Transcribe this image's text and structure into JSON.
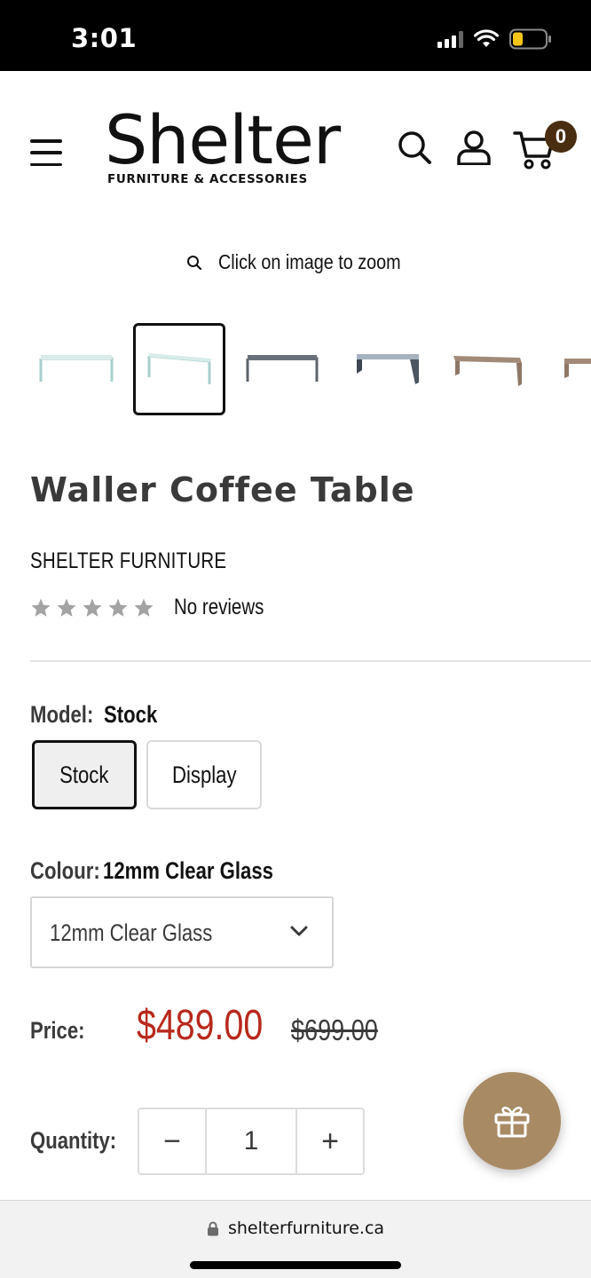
{
  "status_bar": {
    "time": "3:01",
    "icons": [
      "signal-icon",
      "wifi-icon",
      "battery-icon"
    ]
  },
  "header": {
    "menu_icon": "hamburger-menu-icon",
    "logo_title": "Shelter",
    "logo_subtitle": "FURNITURE & ACCESSORIES",
    "search_icon": "search-icon",
    "account_icon": "user-icon",
    "cart_icon": "cart-icon",
    "cart_count": "0"
  },
  "gallery": {
    "zoom_hint": "Click on image to zoom",
    "selected_index": 1,
    "thumbnails": [
      {
        "name": "clear glass table",
        "color": "#c9e3e2"
      },
      {
        "name": "clear glass table angled",
        "color": "#d3e6e5"
      },
      {
        "name": "smoked grey table",
        "color": "#5d636b"
      },
      {
        "name": "dark grey table angled",
        "color": "#4c5560"
      },
      {
        "name": "bronze table",
        "color": "#a28a78"
      },
      {
        "name": "bronze table partial",
        "color": "#a28a78"
      }
    ]
  },
  "product": {
    "title": "Waller Coffee Table",
    "vendor": "SHELTER FURNITURE",
    "rating": 0,
    "rating_max": 5,
    "reviews_text": "No reviews"
  },
  "options": {
    "model_label": "Model:",
    "model_value": "Stock",
    "model_choices": [
      "Stock",
      "Display"
    ],
    "colour_label": "Colour:",
    "colour_value": "12mm Clear Glass",
    "colour_selected": "12mm Clear Glass"
  },
  "pricing": {
    "label": "Price:",
    "sale_price": "$489.00",
    "compare_price": "$699.00",
    "sale_color": "#b8281c"
  },
  "quantity": {
    "label": "Quantity:",
    "value": "1",
    "minus": "−",
    "plus": "+"
  },
  "gift_button_icon": "gift-icon",
  "browser": {
    "url": "shelterfurniture.ca",
    "lock_icon": "lock-icon"
  }
}
